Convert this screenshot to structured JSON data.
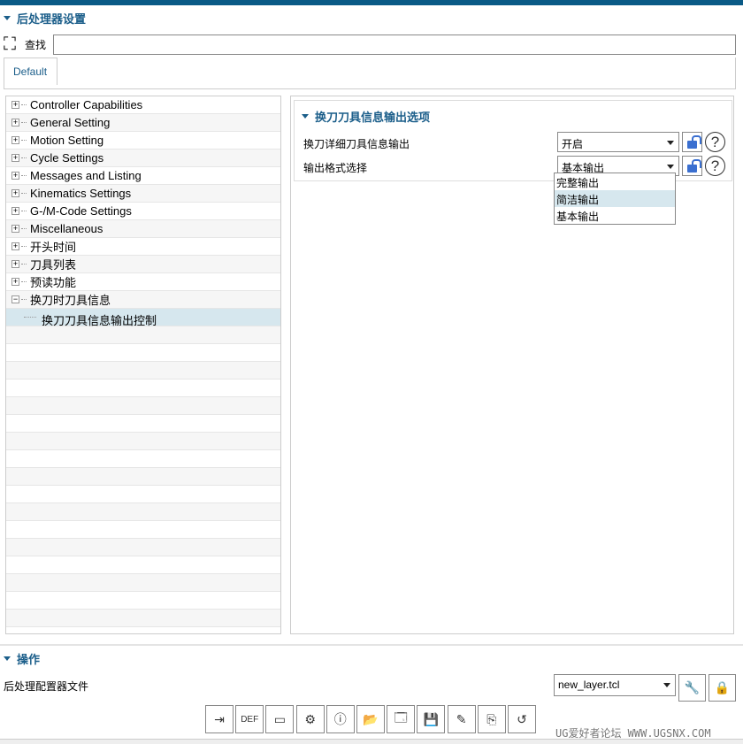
{
  "header": {
    "title": "后处理器设置"
  },
  "search": {
    "label": "查找",
    "value": ""
  },
  "tabs": [
    {
      "label": "Default"
    }
  ],
  "tree": [
    {
      "label": "Controller Capabilities",
      "expand": "+"
    },
    {
      "label": "General Setting",
      "expand": "+"
    },
    {
      "label": "Motion Setting",
      "expand": "+"
    },
    {
      "label": "Cycle Settings",
      "expand": "+"
    },
    {
      "label": "Messages and Listing",
      "expand": "+"
    },
    {
      "label": "Kinematics Settings",
      "expand": "+"
    },
    {
      "label": "G-/M-Code Settings",
      "expand": "+"
    },
    {
      "label": "Miscellaneous",
      "expand": "+"
    },
    {
      "label": "开头时间",
      "expand": "+"
    },
    {
      "label": "刀具列表",
      "expand": "+"
    },
    {
      "label": "预读功能",
      "expand": "+"
    },
    {
      "label": "换刀时刀具信息",
      "expand": "−"
    },
    {
      "label": "换刀刀具信息输出控制",
      "child": true,
      "selected": true
    }
  ],
  "options": {
    "title": "换刀刀具信息输出选项",
    "rows": [
      {
        "label": "换刀详细刀具信息输出",
        "value": "开启"
      },
      {
        "label": "输出格式选择",
        "value": "基本输出"
      }
    ],
    "help": "?",
    "dropdown_open": [
      "完整输出",
      "简洁输出",
      "基本输出"
    ],
    "dropdown_highlight": "简洁输出"
  },
  "operations": {
    "title": "操作",
    "file_label": "后处理配置器文件",
    "file_value": "new_layer.tcl"
  },
  "toolbar": [
    "exit",
    "def-file",
    "template",
    "layers-settings",
    "info",
    "open",
    "save-as-window",
    "save",
    "save-edit",
    "copy-files",
    "undo"
  ],
  "watermark": "UG爱好者论坛 WWW.UGSNX.COM"
}
